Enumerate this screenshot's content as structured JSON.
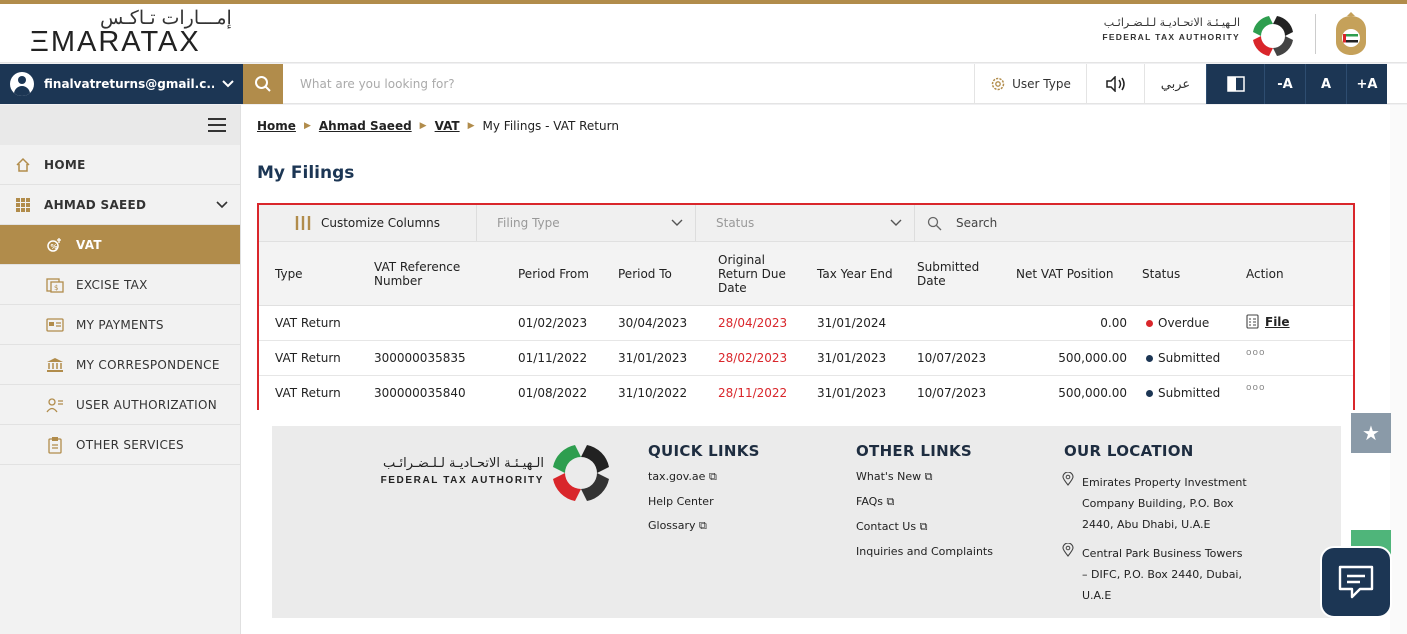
{
  "header": {
    "logo_arabic": "إمـــارات تـاكـس",
    "logo_english": "ΞMARATAX",
    "fta_arabic": "الـهيـئـة الاتحـاديـة لـلـضـرائـب",
    "fta_english": "FEDERAL TAX AUTHORITY"
  },
  "topbar": {
    "user_email": "finalvatreturns@gmail.c...",
    "search_placeholder": "What are you looking for?",
    "user_type_label": "User Type",
    "language_label": "عربي",
    "font_decrease": "-A",
    "font_normal": "A",
    "font_increase": "+A"
  },
  "sidebar": {
    "items": [
      {
        "label": "HOME",
        "icon": "home-icon"
      },
      {
        "label": "AHMAD SAEED",
        "icon": "grid-icon"
      },
      {
        "label": "VAT",
        "icon": "vat-icon",
        "active": true
      },
      {
        "label": "EXCISE TAX",
        "icon": "excise-icon"
      },
      {
        "label": "MY PAYMENTS",
        "icon": "payments-icon"
      },
      {
        "label": "MY CORRESPONDENCE",
        "icon": "bank-icon"
      },
      {
        "label": "USER AUTHORIZATION",
        "icon": "user-auth-icon"
      },
      {
        "label": "OTHER SERVICES",
        "icon": "clipboard-icon"
      }
    ]
  },
  "breadcrumb": {
    "home": "Home",
    "entity": "Ahmad Saeed",
    "vat": "VAT",
    "current": "My Filings - VAT Return"
  },
  "page_title": "My Filings",
  "filters": {
    "customize": "Customize Columns",
    "filing_type": "Filing Type",
    "status": "Status",
    "search": "Search"
  },
  "table": {
    "headers": {
      "type": "Type",
      "vat_ref_1": "VAT Reference",
      "vat_ref_2": "Number",
      "period_from": "Period From",
      "period_to": "Period To",
      "due_1": "Original",
      "due_2": "Return Due",
      "due_3": "Date",
      "tax_year_end": "Tax Year End",
      "submitted_1": "Submitted",
      "submitted_2": "Date",
      "net_vat": "Net VAT Position",
      "status": "Status",
      "action": "Action"
    },
    "rows": [
      {
        "type": "VAT Return",
        "ref": "",
        "from": "01/02/2023",
        "to": "30/04/2023",
        "due": "28/04/2023",
        "tye": "31/01/2024",
        "submitted": "",
        "net": "0.00",
        "status": "Overdue",
        "action": "File"
      },
      {
        "type": "VAT Return",
        "ref": "300000035835",
        "from": "01/11/2022",
        "to": "31/01/2023",
        "due": "28/02/2023",
        "tye": "31/01/2023",
        "submitted": "10/07/2023",
        "net": "500,000.00",
        "status": "Submitted",
        "action": "ooo"
      },
      {
        "type": "VAT Return",
        "ref": "300000035840",
        "from": "01/08/2022",
        "to": "31/10/2022",
        "due": "28/11/2022",
        "tye": "31/01/2023",
        "submitted": "10/07/2023",
        "net": "500,000.00",
        "status": "Submitted",
        "action": "ooo"
      }
    ]
  },
  "footer": {
    "fta_arabic": "الـهيـئـة الاتحـاديـة لـلـضـرائـب",
    "fta_english": "FEDERAL TAX AUTHORITY",
    "quick_links_title": "QUICK LINKS",
    "quick_links": [
      "tax.gov.ae",
      "Help Center",
      "Glossary"
    ],
    "other_links_title": "OTHER LINKS",
    "other_links": [
      "What's New",
      "FAQs",
      "Contact Us",
      "Inquiries and Complaints"
    ],
    "location_title": "OUR LOCATION",
    "location_1": [
      "Emirates Property Investment",
      "Company Building, P.O. Box",
      "2440, Abu Dhabi, U.A.E"
    ],
    "location_2": [
      "Central Park Business Towers",
      "– DIFC, P.O. Box 2440, Dubai,",
      "U.A.E"
    ]
  },
  "colors": {
    "navy": "#1c3654",
    "gold": "#b18c4b",
    "red": "#d9262b"
  }
}
